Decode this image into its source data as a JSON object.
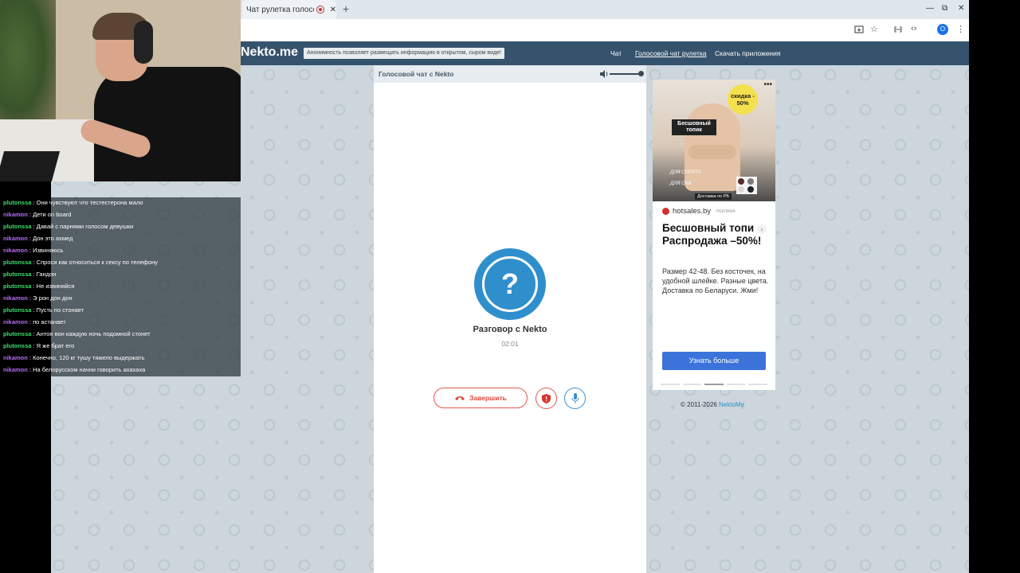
{
  "browser": {
    "tab_title": "Чат рулетка голосовой",
    "tab_close": "✕",
    "new_tab": "+",
    "window_controls": [
      "—",
      "⧉",
      "✕"
    ],
    "avatar_letter": "O"
  },
  "site": {
    "logo": "Nekto.me",
    "notice": "Анонимность позволяет размещать информацию в открытом, сыром виде!",
    "nav": [
      "Чат",
      "Голосовой чат рулетка",
      "Скачать приложения"
    ],
    "active_nav": "Голосовой чат рулетка"
  },
  "chat_panel": {
    "header_title": "Голосовой чат с Nekto",
    "avatar_symbol": "?",
    "conversation_title": "Разговор с Nekto",
    "timer": "02:01",
    "end_button_label": "Завершить",
    "volume_level": 0.9
  },
  "ad": {
    "badge_text": "скидка - 50%",
    "topic_label": "Бесшовный топик",
    "checks": [
      "ДЛЯ СПОРТА",
      "ДЛЯ СНА"
    ],
    "delivery": "Доставка по РБ",
    "swatch_colors": [
      "#5a2a2a",
      "#7a7a7a",
      "#d9d9d9",
      "#222222"
    ],
    "brand": "hotsales.by",
    "ad_mark": "РЕКЛАМА",
    "headline": "Бесшовный топи\nРаспродажа –50%!",
    "description": "Размер 42-48. Без косточек, на удобной шлейке. Разные цвета. Доставка по Беларуси. Жми!",
    "cta": "Узнать больше",
    "carousel_slides": 5,
    "carousel_active": 2,
    "menu_dots": "•••",
    "arrow": "›"
  },
  "footer": {
    "copyright": "© 2011-2026",
    "link": "NektoMe"
  },
  "stream_chat": [
    {
      "user": "plutonssa",
      "text": ": Они чувствуют что тестестерона мало"
    },
    {
      "user": "nikamon",
      "text": ": Дети on board"
    },
    {
      "user": "plutonssa",
      "text": ": Давай с парнями голосом девушки"
    },
    {
      "user": "nikamon",
      "text": ": Дон это ахмед"
    },
    {
      "user": "nikamon",
      "text": ": Извиняюсь"
    },
    {
      "user": "plutonssa",
      "text": ": Спроси как относиться к сексу по телефону"
    },
    {
      "user": "plutonssa",
      "text": ": Гандон"
    },
    {
      "user": "plutonssa",
      "text": ": Не извиняйся"
    },
    {
      "user": "nikamon",
      "text": ": Э рон дон дон"
    },
    {
      "user": "plutonssa",
      "text": ": Пусть по стонает"
    },
    {
      "user": "nikamon",
      "text": ": по астанает"
    },
    {
      "user": "plutonssa",
      "text": ": Антон вон каждую ночь подомной стонет"
    },
    {
      "user": "plutonssa",
      "text": ": Я же брат его"
    },
    {
      "user": "nikamon",
      "text": ": Конечно, 120 кг тушу тяжело выдержать"
    },
    {
      "user": "nikamon",
      "text": ": На белорусском начни говорить ахахаха"
    }
  ]
}
